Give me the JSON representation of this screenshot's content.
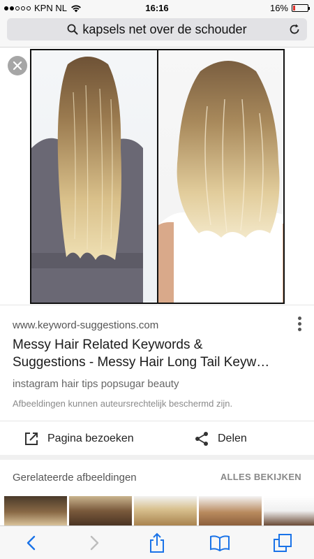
{
  "status": {
    "carrier": "KPN NL",
    "time": "16:16",
    "battery": "16%",
    "battery_level": 0.16,
    "signal_bars_filled": 2,
    "signal_bars_total": 5
  },
  "search": {
    "query": "kapsels net over de schouder"
  },
  "result": {
    "domain": "www.keyword-suggestions.com",
    "title_line1": "Messy Hair Related Keywords &",
    "title_line2": "Suggestions - Messy Hair Long Tail Keyw…",
    "tags": "instagram hair tips popsugar beauty",
    "copyright": "Afbeeldingen kunnen auteursrechtelijk beschermd zijn.",
    "visit_label": "Pagina bezoeken",
    "share_label": "Delen"
  },
  "related": {
    "title": "Gerelateerde afbeeldingen",
    "see_all": "ALLES BEKIJKEN"
  },
  "colors": {
    "accent_blue": "#1a73e8",
    "battery_red": "#e0312b"
  },
  "icons": {
    "search": "search-icon",
    "reload": "reload-icon",
    "close": "close-icon",
    "more": "more-vert-icon",
    "open": "open-in-new-icon",
    "share": "share-icon",
    "back": "back-icon",
    "forward": "forward-icon",
    "share_sheet": "share-sheet-icon",
    "bookmarks": "bookmarks-icon",
    "tabs": "tabs-icon"
  }
}
